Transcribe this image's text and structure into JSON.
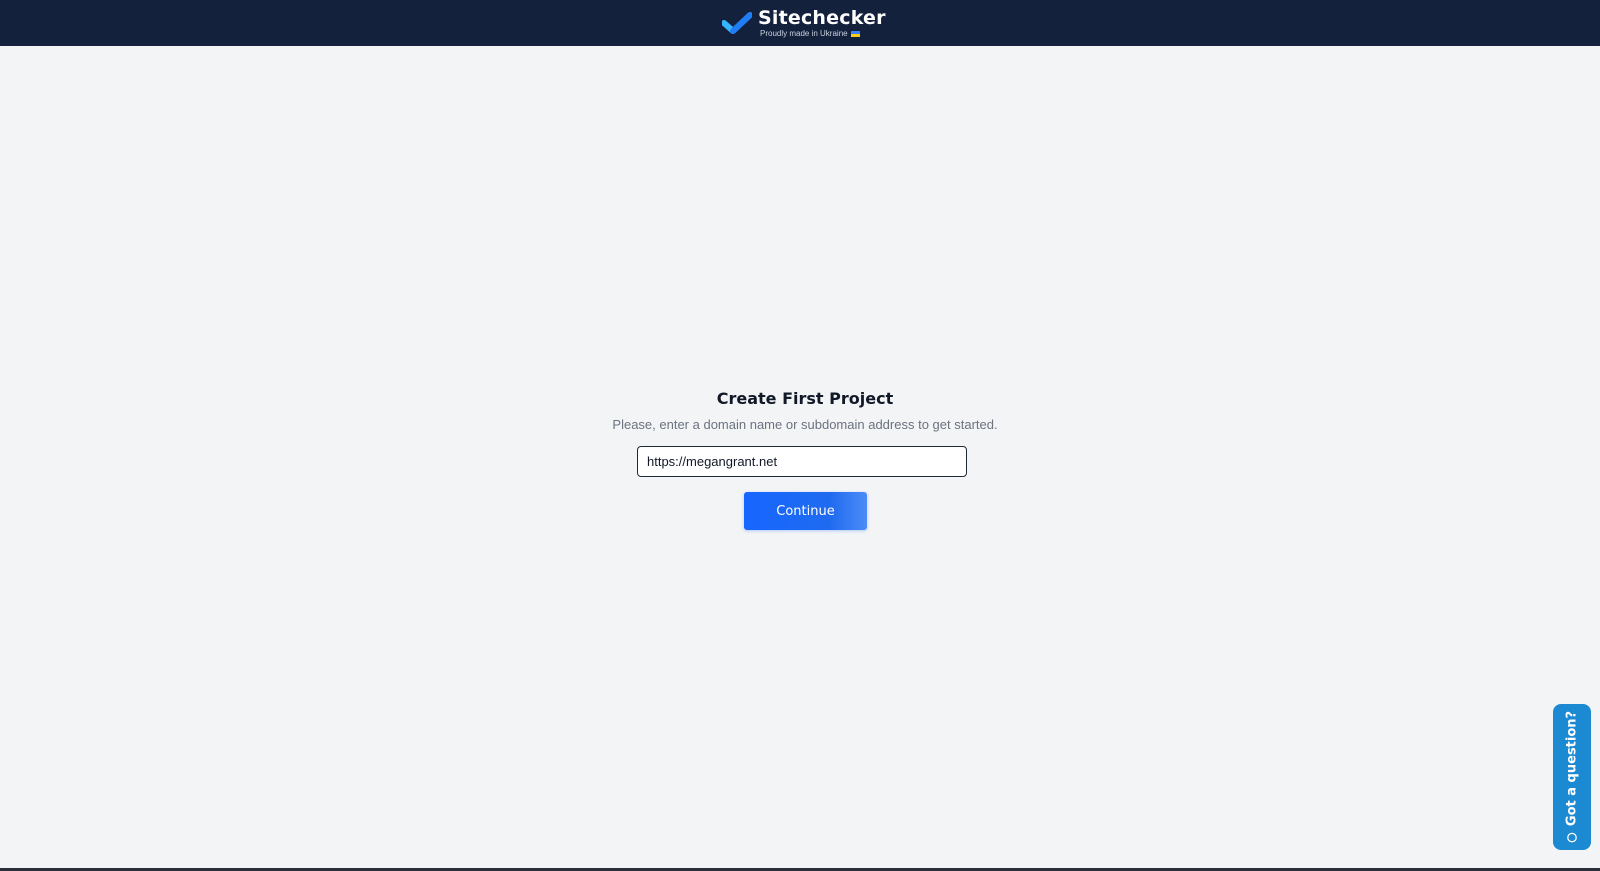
{
  "header": {
    "brand": "Sitechecker",
    "tagline": "Proudly made in Ukraine",
    "logo_icon": "check-mark-logo-icon",
    "flag_icon": "ukraine-flag-icon",
    "background": "#13213c"
  },
  "form": {
    "title": "Create First Project",
    "subtitle": "Please, enter a domain name or subdomain address to get started.",
    "url_value": "https://megangrant.net",
    "continue_label": "Continue",
    "button_color": "#1766ff"
  },
  "help_widget": {
    "label": "Got a question?",
    "icon": "chat-bubble-icon",
    "color": "#1c8ad3"
  }
}
